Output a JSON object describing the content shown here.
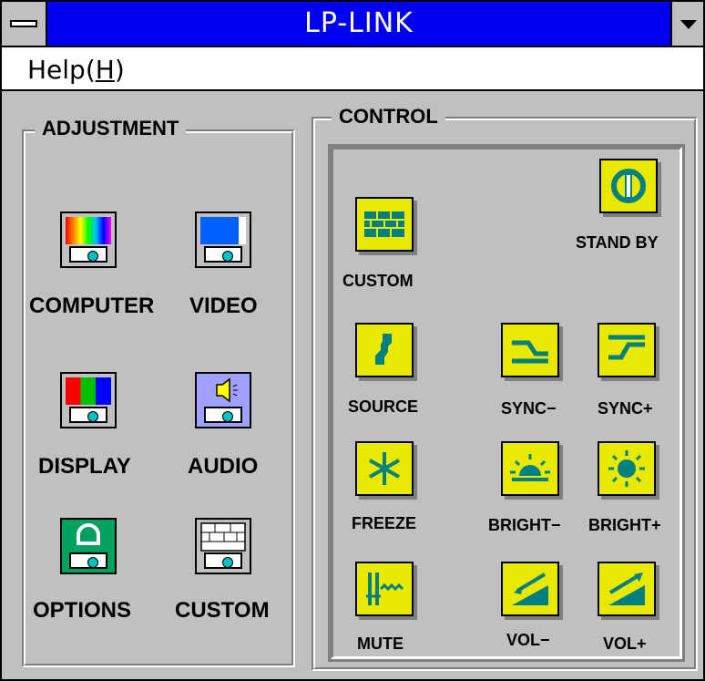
{
  "window": {
    "title": "LP-LINK"
  },
  "menu": {
    "help_prefix": "Help(",
    "help_mnemonic": "H",
    "help_suffix": ")"
  },
  "adjustment": {
    "title": "ADJUSTMENT",
    "items": [
      {
        "label": "COMPUTER",
        "icon": "computer-rainbow-icon"
      },
      {
        "label": "VIDEO",
        "icon": "video-icon"
      },
      {
        "label": "DISPLAY",
        "icon": "display-icon"
      },
      {
        "label": "AUDIO",
        "icon": "speaker-icon"
      },
      {
        "label": "OPTIONS",
        "icon": "options-icon"
      },
      {
        "label": "CUSTOM",
        "icon": "custom-grid-icon"
      }
    ]
  },
  "control": {
    "title": "CONTROL",
    "items": [
      {
        "label": "CUSTOM",
        "icon": "custom-bricks-icon"
      },
      {
        "label": "STAND BY",
        "icon": "power-icon"
      },
      {
        "label": "SOURCE",
        "icon": "source-icon"
      },
      {
        "label": "SYNC−",
        "icon": "sync-minus-icon"
      },
      {
        "label": "SYNC+",
        "icon": "sync-plus-icon"
      },
      {
        "label": "FREEZE",
        "icon": "freeze-icon"
      },
      {
        "label": "BRIGHT−",
        "icon": "bright-minus-icon"
      },
      {
        "label": "BRIGHT+",
        "icon": "bright-plus-icon"
      },
      {
        "label": "MUTE",
        "icon": "mute-icon"
      },
      {
        "label": "VOL−",
        "icon": "volume-down-icon"
      },
      {
        "label": "VOL+",
        "icon": "volume-up-icon"
      }
    ]
  },
  "colors": {
    "titlebar": "#0000f0",
    "face": "#c0c0c0",
    "button_yellow": "#e8e800",
    "accent_teal": "#008080"
  }
}
